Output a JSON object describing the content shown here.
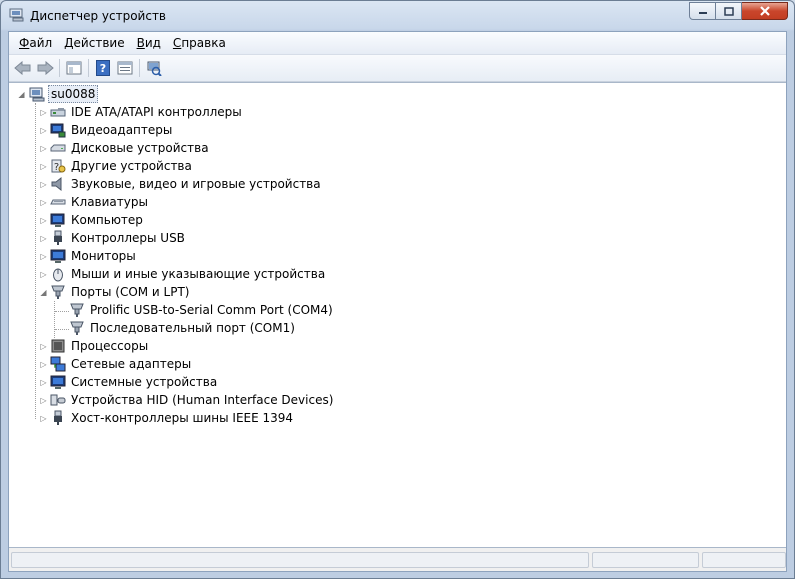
{
  "window": {
    "title": "Диспетчер устройств"
  },
  "menubar": {
    "items": [
      {
        "underline": "Ф",
        "rest": "айл"
      },
      {
        "underline": "Д",
        "rest": "ействие"
      },
      {
        "underline": "В",
        "rest": "ид"
      },
      {
        "underline": "С",
        "rest": "правка"
      }
    ]
  },
  "toolbar": {
    "icons": [
      "back-arrow-icon",
      "forward-arrow-icon",
      "show-hide-tree-icon",
      "help-icon",
      "properties-icon",
      "scan-hardware-icon"
    ]
  },
  "tree": {
    "root": "su0088",
    "categories": [
      {
        "label": "IDE ATA/ATAPI контроллеры",
        "icon": "ide-controller-icon",
        "expanded": false
      },
      {
        "label": "Видеоадаптеры",
        "icon": "display-adapter-icon",
        "expanded": false
      },
      {
        "label": "Дисковые устройства",
        "icon": "disk-drive-icon",
        "expanded": false
      },
      {
        "label": "Другие устройства",
        "icon": "unknown-device-icon",
        "expanded": false
      },
      {
        "label": "Звуковые, видео и игровые устройства",
        "icon": "speaker-icon",
        "expanded": false
      },
      {
        "label": "Клавиатуры",
        "icon": "keyboard-icon",
        "expanded": false
      },
      {
        "label": "Компьютер",
        "icon": "computer-icon",
        "expanded": false
      },
      {
        "label": "Контроллеры USB",
        "icon": "usb-plug-icon",
        "expanded": false
      },
      {
        "label": "Мониторы",
        "icon": "monitor-icon",
        "expanded": false
      },
      {
        "label": "Мыши и иные указывающие устройства",
        "icon": "mouse-icon",
        "expanded": false
      },
      {
        "label": "Порты (COM и LPT)",
        "icon": "port-icon",
        "expanded": true
      },
      {
        "label": "Процессоры",
        "icon": "processor-icon",
        "expanded": false
      },
      {
        "label": "Сетевые адаптеры",
        "icon": "network-adapter-icon",
        "expanded": false
      },
      {
        "label": "Системные устройства",
        "icon": "system-device-icon",
        "expanded": false
      },
      {
        "label": "Устройства HID (Human Interface Devices)",
        "icon": "hid-icon",
        "expanded": false
      },
      {
        "label": "Хост-контроллеры шины IEEE 1394",
        "icon": "ieee1394-icon",
        "expanded": false
      }
    ],
    "ports_children": [
      {
        "label": "Prolific USB-to-Serial Comm Port (COM4)",
        "icon": "port-icon"
      },
      {
        "label": "Последовательный порт (COM1)",
        "icon": "port-icon"
      }
    ]
  },
  "colors": {
    "title_bg": "#c8d7ea",
    "selection_border": "#7a8aa0",
    "close_button": "#c9462c"
  }
}
